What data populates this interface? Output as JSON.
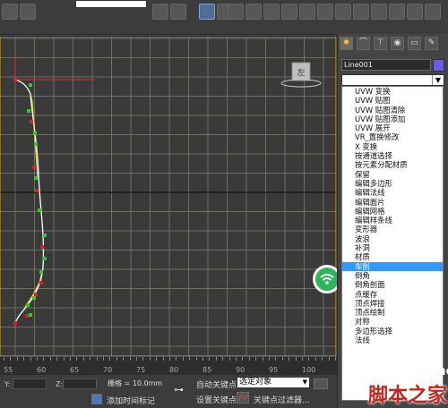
{
  "toolbar": {
    "icons": [
      "undo-icon",
      "redo-icon",
      "select-icon",
      "select-by-name-icon",
      "rect-select-icon",
      "window-crossing-icon",
      "move-icon",
      "rotate-icon",
      "scale-icon",
      "ref-coord-icon",
      "pivot-icon",
      "snap-icon",
      "angle-snap-icon",
      "mirror-icon",
      "align-icon",
      "layer-icon",
      "curve-editor-icon",
      "schematic-icon",
      "material-editor-icon",
      "render-setup-icon",
      "render-icon"
    ]
  },
  "viewport": {
    "gizmo_label": "左",
    "grid_color": "#6f6f62",
    "spline_color": "#ffffff",
    "vertex_colors": [
      "#32c832",
      "#e02020",
      "#ffff40"
    ]
  },
  "timeline": {
    "ticks": [
      "55",
      "60",
      "65",
      "70",
      "75",
      "80",
      "85",
      "90",
      "95",
      "100"
    ]
  },
  "status": {
    "y_label": "Y:",
    "z_label": "Z:",
    "grid_text": "栅格 = 10.0mm",
    "add_time_tag": "添加时间标记",
    "auto_key": "自动关键点",
    "selected_object": "选定对象",
    "set_key": "设置关键点",
    "key_filters": "关键点过滤器..."
  },
  "panel": {
    "object_name": "Line001",
    "object_color": "#6b5ce6",
    "modifier_list": [
      "UVW 变换",
      "UVW 贴图",
      "UVW 贴图清除",
      "UVW 贴图添加",
      "UVW 展开",
      "VR_置换修改",
      "X 变换",
      "按通道选择",
      "按元素分配材质",
      "保留",
      "编辑多边形",
      "编辑法线",
      "编辑面片",
      "编辑网格",
      "编辑样条线",
      "变形器",
      "波浪",
      "补洞",
      "材质",
      "车削",
      "倒角",
      "倒角剖面",
      "点缓存",
      "顶点焊接",
      "顶点绘制",
      "对称",
      "多边形选择",
      "法线"
    ],
    "selected_modifier": "车削"
  },
  "watermark": {
    "site": "jb51.net",
    "name": "脚本之家"
  }
}
